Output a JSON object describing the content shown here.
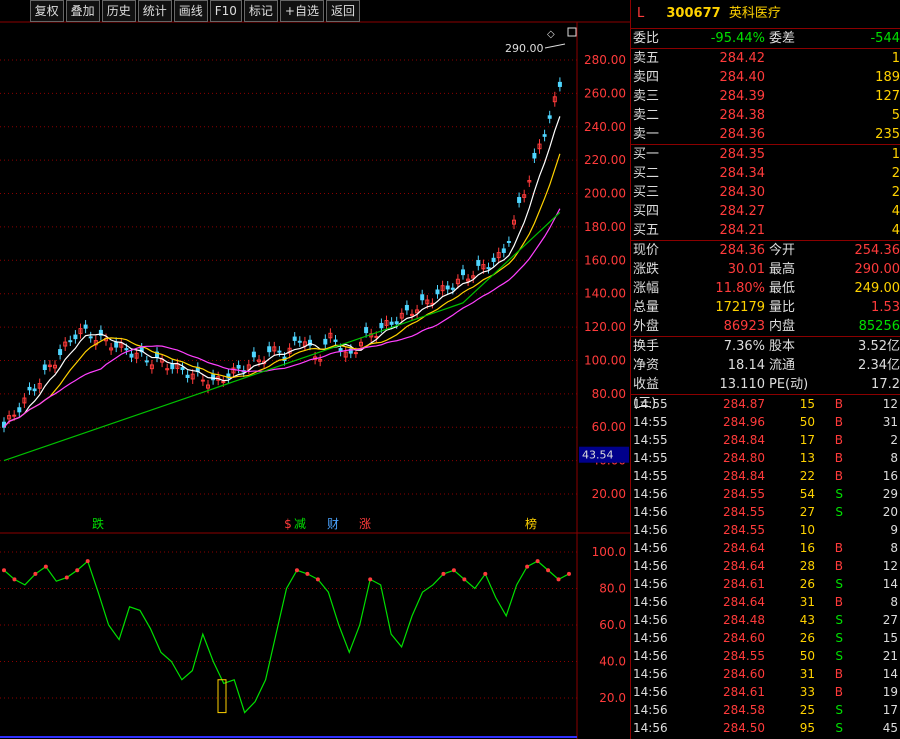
{
  "toolbar": [
    "复权",
    "叠加",
    "历史",
    "统计",
    "画线",
    "F10",
    "标记",
    "+自选",
    "返回"
  ],
  "chart": {
    "price_axis": [
      "280.00",
      "260.00",
      "240.00",
      "220.00",
      "200.00",
      "180.00",
      "160.00",
      "140.00",
      "120.00",
      "100.00",
      "80.00",
      "60.00",
      "40.00",
      "20.00"
    ],
    "current_marker": "43.54",
    "high_label": "290.00",
    "events": [
      {
        "text": "跌",
        "color": "#00e000"
      },
      {
        "text": "$",
        "color": "#ff3b3b"
      },
      {
        "text": "减",
        "color": "#00e000"
      },
      {
        "text": "财",
        "color": "#4aa3ff"
      },
      {
        "text": "涨",
        "color": "#ff3b3b"
      },
      {
        "text": "榜",
        "color": "#ffd200"
      }
    ],
    "indicator_axis": [
      "100.0",
      "80.0",
      "60.0",
      "40.0",
      "20.0"
    ],
    "colors": {
      "ma5": "#ffffff",
      "ma10": "#ffd200",
      "ma20": "#ff40ff",
      "ma60": "#00c000",
      "up": "#ff3b3b",
      "down": "#4fd6ff",
      "grid": "#8b0000"
    }
  },
  "quote": {
    "flag": "L",
    "code": "300677",
    "name": "英科医疗",
    "weibi_label": "委比",
    "weibi": "-95.44%",
    "weicha_label": "委差",
    "weicha": "-544",
    "asks": [
      {
        "label": "卖五",
        "price": "284.42",
        "vol": "1"
      },
      {
        "label": "卖四",
        "price": "284.40",
        "vol": "189"
      },
      {
        "label": "卖三",
        "price": "284.39",
        "vol": "127"
      },
      {
        "label": "卖二",
        "price": "284.38",
        "vol": "5"
      },
      {
        "label": "卖一",
        "price": "284.36",
        "vol": "235"
      }
    ],
    "bids": [
      {
        "label": "买一",
        "price": "284.35",
        "vol": "1"
      },
      {
        "label": "买二",
        "price": "284.34",
        "vol": "2"
      },
      {
        "label": "买三",
        "price": "284.30",
        "vol": "2"
      },
      {
        "label": "买四",
        "price": "284.27",
        "vol": "4"
      },
      {
        "label": "买五",
        "price": "284.21",
        "vol": "4"
      }
    ],
    "stats": [
      {
        "l1": "现价",
        "v1": "284.36",
        "c1": "red",
        "l2": "今开",
        "v2": "254.36",
        "c2": "red"
      },
      {
        "l1": "涨跌",
        "v1": "30.01",
        "c1": "red",
        "l2": "最高",
        "v2": "290.00",
        "c2": "red"
      },
      {
        "l1": "涨幅",
        "v1": "11.80%",
        "c1": "red",
        "l2": "最低",
        "v2": "249.00",
        "c2": "yellow"
      },
      {
        "l1": "总量",
        "v1": "172179",
        "c1": "yellow",
        "l2": "量比",
        "v2": "1.53",
        "c2": "red"
      },
      {
        "l1": "外盘",
        "v1": "86923",
        "c1": "red",
        "l2": "内盘",
        "v2": "85256",
        "c2": "green"
      }
    ],
    "stats2": [
      {
        "l1": "换手",
        "v1": "7.36%",
        "l2": "股本",
        "v2": "3.52亿"
      },
      {
        "l1": "净资",
        "v1": "18.14",
        "l2": "流通",
        "v2": "2.34亿"
      },
      {
        "l1": "收益(三)",
        "v1": "13.110",
        "l2": "PE(动)",
        "v2": "17.2"
      }
    ],
    "ticks": [
      {
        "time": "14:55",
        "price": "284.87",
        "vol": "15",
        "bs": "B",
        "n": "12"
      },
      {
        "time": "14:55",
        "price": "284.96",
        "vol": "50",
        "bs": "B",
        "n": "31"
      },
      {
        "time": "14:55",
        "price": "284.84",
        "vol": "17",
        "bs": "B",
        "n": "2"
      },
      {
        "time": "14:55",
        "price": "284.80",
        "vol": "13",
        "bs": "B",
        "n": "8"
      },
      {
        "time": "14:55",
        "price": "284.84",
        "vol": "22",
        "bs": "B",
        "n": "16"
      },
      {
        "time": "14:56",
        "price": "284.55",
        "vol": "54",
        "bs": "S",
        "n": "29"
      },
      {
        "time": "14:56",
        "price": "284.55",
        "vol": "27",
        "bs": "S",
        "n": "20"
      },
      {
        "time": "14:56",
        "price": "284.55",
        "vol": "10",
        "bs": "",
        "n": "9"
      },
      {
        "time": "14:56",
        "price": "284.64",
        "vol": "16",
        "bs": "B",
        "n": "8"
      },
      {
        "time": "14:56",
        "price": "284.64",
        "vol": "28",
        "bs": "B",
        "n": "12"
      },
      {
        "time": "14:56",
        "price": "284.61",
        "vol": "26",
        "bs": "S",
        "n": "14"
      },
      {
        "time": "14:56",
        "price": "284.64",
        "vol": "31",
        "bs": "B",
        "n": "8"
      },
      {
        "time": "14:56",
        "price": "284.48",
        "vol": "43",
        "bs": "S",
        "n": "27"
      },
      {
        "time": "14:56",
        "price": "284.60",
        "vol": "26",
        "bs": "S",
        "n": "15"
      },
      {
        "time": "14:56",
        "price": "284.55",
        "vol": "50",
        "bs": "S",
        "n": "21"
      },
      {
        "time": "14:56",
        "price": "284.60",
        "vol": "31",
        "bs": "B",
        "n": "14"
      },
      {
        "time": "14:56",
        "price": "284.61",
        "vol": "33",
        "bs": "B",
        "n": "19"
      },
      {
        "time": "14:56",
        "price": "284.58",
        "vol": "25",
        "bs": "S",
        "n": "17"
      },
      {
        "time": "14:56",
        "price": "284.50",
        "vol": "95",
        "bs": "S",
        "n": "45"
      }
    ]
  }
}
